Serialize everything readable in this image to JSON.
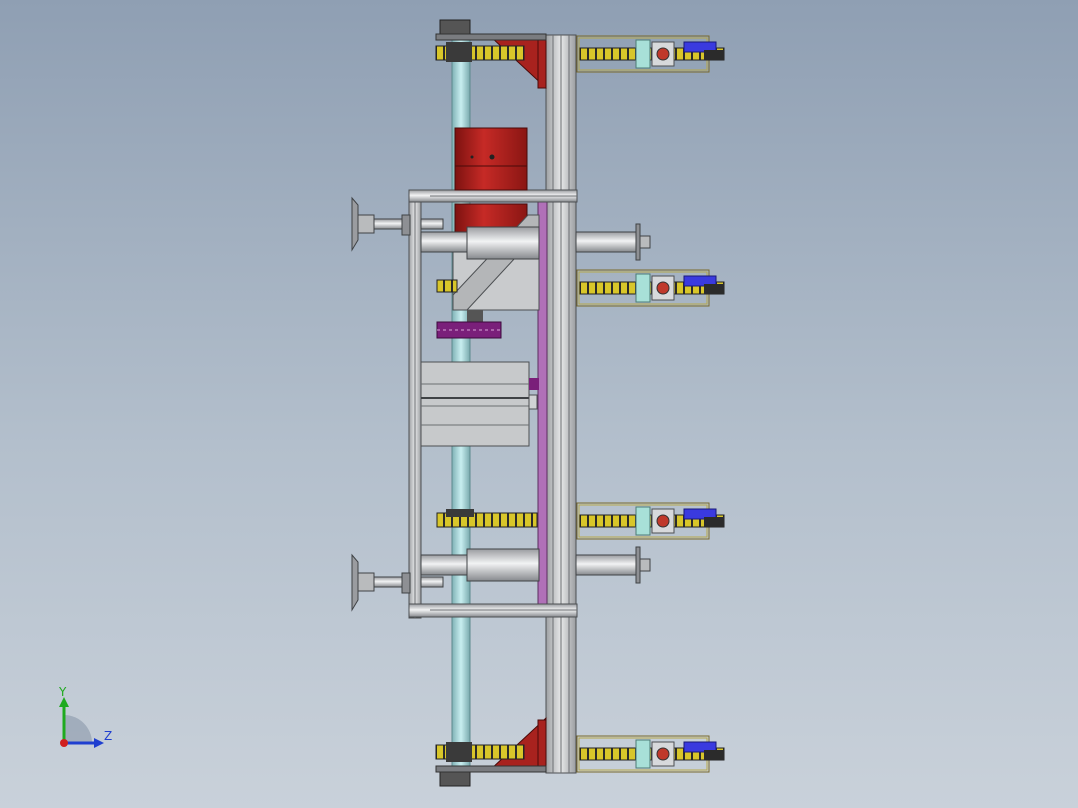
{
  "viewport": {
    "background_top": "#8f9fb3",
    "background_bottom": "#c9d1da"
  },
  "colors": {
    "frame": "#c4c6c8",
    "frame_edge": "#55585c",
    "shaft": "#9cc9cc",
    "motor_red": "#b3201f",
    "bracket_red": "#a8221e",
    "chain_yellow": "#d8c62a",
    "chain_dark": "#2b2b2b",
    "purple_plate": "#b070b8",
    "cylinder": "#d6d8da",
    "gear_purple": "#7a1f7a",
    "blue_block": "#3a3adf",
    "cyan_block": "#a8e0d8"
  },
  "triad": {
    "y_label": "Y",
    "z_label": "Z",
    "y_color": "#1faa1f",
    "z_color": "#1f3fd0",
    "origin_color": "#d01f1f",
    "icon": "coordinate-triad-icon"
  }
}
